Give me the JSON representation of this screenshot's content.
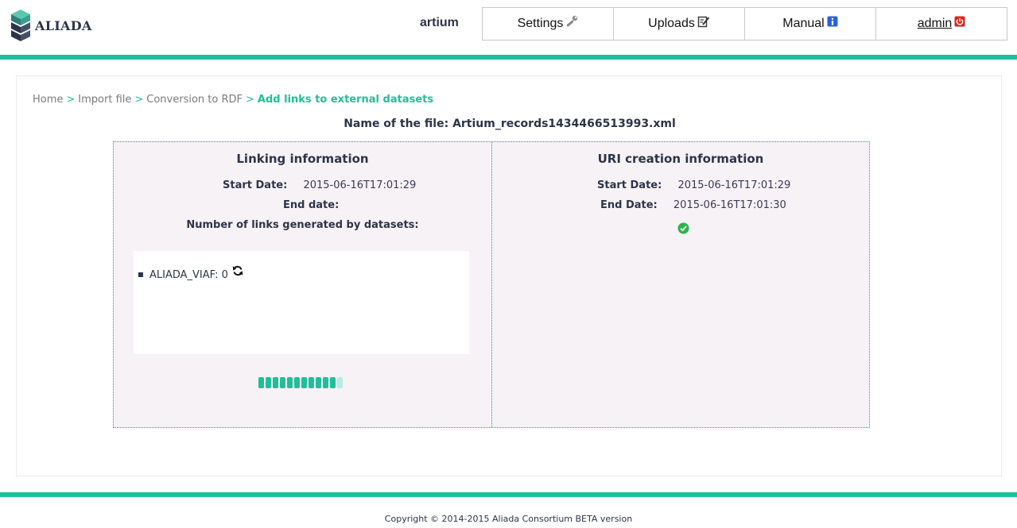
{
  "app": {
    "logo_text": "ALIADA",
    "username": "artium"
  },
  "nav": [
    {
      "label": "Settings",
      "icon": "wrench-icon"
    },
    {
      "label": "Uploads",
      "icon": "edit-icon"
    },
    {
      "label": "Manual",
      "icon": "info-icon"
    },
    {
      "label": "admin",
      "icon": "power-icon"
    }
  ],
  "breadcrumb": [
    "Home",
    "Import file",
    "Conversion to RDF",
    "Add links to external datasets"
  ],
  "breadcrumb_sep": ">",
  "file": {
    "label": "Name of the file: Artium_records1434466513993.xml"
  },
  "linking": {
    "title": "Linking information",
    "start_label": "Start Date:",
    "start_value": "2015-06-16T17:01:29",
    "end_label": "End date:",
    "end_value": "",
    "links_label": "Number of links generated by datasets:",
    "datasets": [
      {
        "text": "ALIADA_VIAF: 0"
      }
    ],
    "progress": {
      "filled": 11,
      "total": 12
    }
  },
  "uri": {
    "title": "URI creation information",
    "start_label": "Start Date:",
    "start_value": "2015-06-16T17:01:29",
    "end_label": "End Date:",
    "end_value": "2015-06-16T17:01:30",
    "status_icon": "check-circle-icon"
  },
  "footer": {
    "text": "Copyright © 2014-2015 Aliada Consortium BETA version"
  },
  "colors": {
    "accent": "#1fbf9a",
    "panel_bg": "#f6f2f6",
    "text": "#2d3448",
    "admin_icon": "#d9251c",
    "manual_icon": "#2f5fd8",
    "check": "#2db34a"
  }
}
